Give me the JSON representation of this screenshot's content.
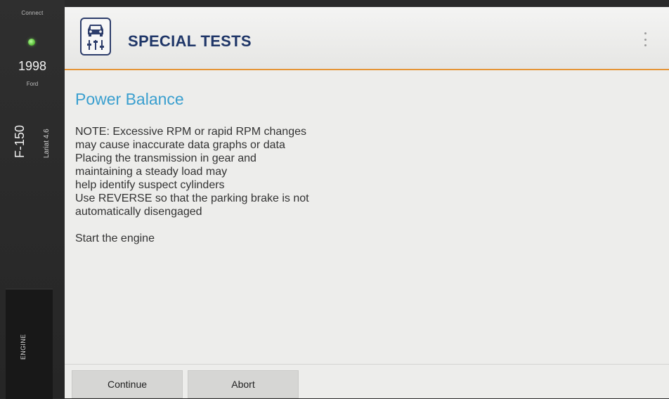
{
  "sidebar": {
    "status": "Connect",
    "led_color": "#5fc23e",
    "year": "1998",
    "make": "Ford",
    "model": "F-150",
    "submodel": "Lariat 4.6",
    "module": "ENGINE"
  },
  "header": {
    "title": "SPECIAL TESTS",
    "icon": "car-settings-icon",
    "accent_color": "#e59436",
    "title_color": "#1f3668"
  },
  "content": {
    "title": "Power Balance",
    "note_lines": [
      "NOTE: Excessive RPM or rapid RPM changes",
      "may cause inaccurate data graphs or data",
      "Placing the transmission in gear and",
      "maintaining a steady load may",
      "help identify suspect cylinders",
      "Use REVERSE so that the parking brake is not",
      "automatically disengaged"
    ],
    "instruction": "Start the engine"
  },
  "buttons": {
    "continue": "Continue",
    "abort": "Abort"
  }
}
